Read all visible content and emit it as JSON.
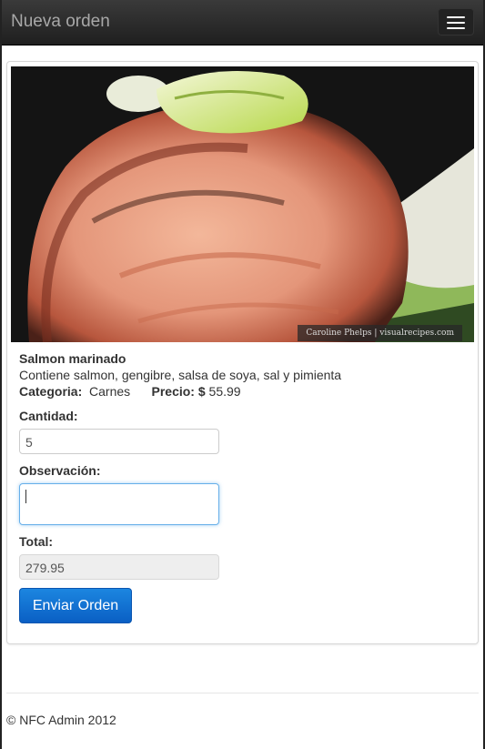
{
  "navbar": {
    "title": "Nueva orden"
  },
  "product": {
    "image_credit": "Caroline Phelps | visualrecipes.com",
    "name": "Salmon marinado",
    "description": "Contiene salmon, gengibre, salsa de soya, sal y pimienta",
    "category_label": "Categoria:",
    "category_value": "Carnes",
    "price_label": "Precio: $",
    "price_value": "55.99"
  },
  "form": {
    "quantity_label": "Cantidad:",
    "quantity_value": "5",
    "observation_label": "Observación:",
    "observation_value": "",
    "total_label": "Total:",
    "total_value": "279.95",
    "submit_label": "Enviar Orden"
  },
  "footer": {
    "text": "© NFC Admin 2012"
  },
  "colors": {
    "navbar": "#2a2a2a",
    "button": "#0a6fd6"
  }
}
